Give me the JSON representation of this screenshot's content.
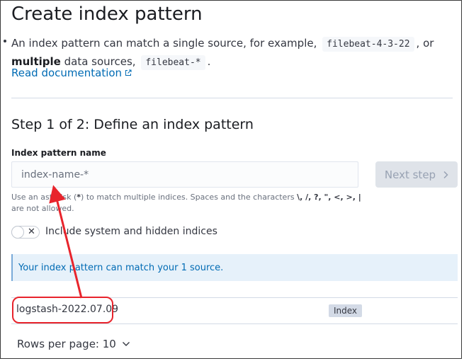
{
  "header": {
    "title": "Create index pattern",
    "desc_part1": "An index pattern can match a single source, for example,",
    "desc_code1": "filebeat-4-3-22",
    "desc_part2": ", or",
    "desc_bold": "multiple",
    "desc_part3": "data sources,",
    "desc_code2": "filebeat-*",
    "desc_part4": ".",
    "doc_link": "Read documentation"
  },
  "step": {
    "heading": "Step 1 of 2: Define an index pattern",
    "field_label": "Index pattern name",
    "input_placeholder": "index-name-*",
    "input_value": "",
    "next_button": "Next step",
    "help_part1": "Use an asterisk (",
    "help_star": "*",
    "help_part2": ") to match multiple indices. Spaces and the characters",
    "help_chars": "\\, /, ?, \", <, >, |",
    "help_part3": "are not allowed."
  },
  "toggle": {
    "label": "Include system and hidden indices",
    "checked": false
  },
  "callout": {
    "text": "Your index pattern can match your 1 source."
  },
  "results": {
    "rows": [
      {
        "name": "logstash-2022.07.09",
        "type": "Index"
      }
    ],
    "rows_per_page": "Rows per page: 10"
  },
  "annotation": {
    "color": "#e8242c"
  },
  "icons": {
    "external_link": "external-link-icon",
    "next_arrow": "chevron-right-icon",
    "rows_caret": "chevron-down-icon",
    "toggle_x": "cross-icon"
  }
}
